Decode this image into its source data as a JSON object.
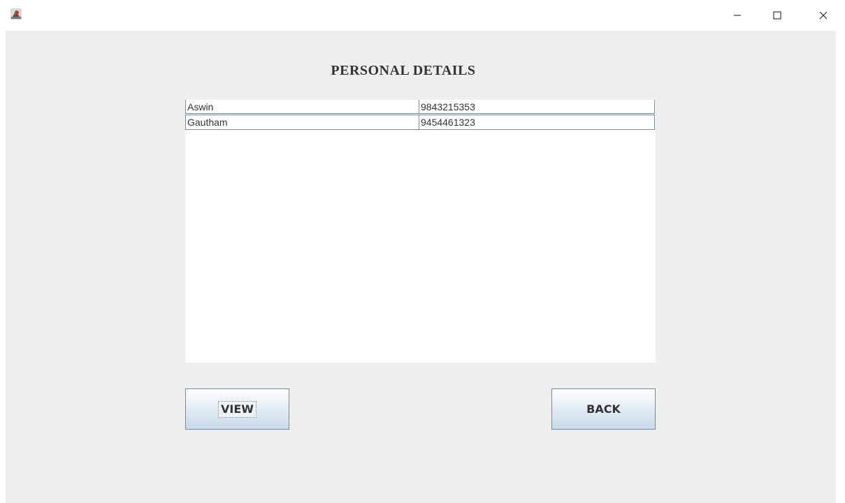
{
  "window": {
    "app_icon": "java-app-icon",
    "controls": [
      "minimize-icon",
      "maximize-icon",
      "close-icon"
    ]
  },
  "page": {
    "title": "PERSONAL DETAILS"
  },
  "table": {
    "rows": [
      {
        "name": "Aswin",
        "phone": "9843215353"
      },
      {
        "name": "Gautham",
        "phone": "9454461323"
      }
    ]
  },
  "buttons": {
    "view_label": "VIEW",
    "back_label": "BACK"
  },
  "colors": {
    "background": "#eeeeee",
    "grid_line": "#7a8a99",
    "button_gradient_top": "#ffffff",
    "button_gradient_bottom": "#c8d9e8"
  }
}
